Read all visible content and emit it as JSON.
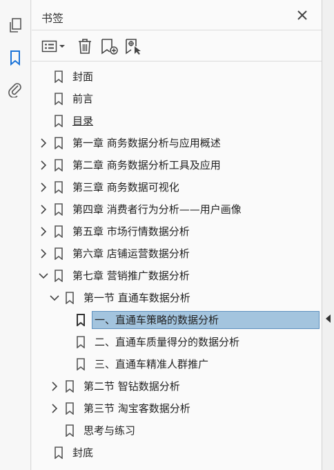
{
  "panel": {
    "title": "书签"
  },
  "rail": {
    "icons": [
      "pages-icon",
      "bookmark-icon",
      "attachment-icon"
    ]
  },
  "toolbar": {
    "icons": [
      "options-menu-icon",
      "delete-icon",
      "new-bookmark-icon",
      "bookmark-from-structure-icon"
    ]
  },
  "bookmarks": [
    {
      "label": "封面",
      "level": 0,
      "expander": "none"
    },
    {
      "label": "前言",
      "level": 0,
      "expander": "none"
    },
    {
      "label": "目录",
      "level": 0,
      "expander": "none",
      "underline": true
    },
    {
      "label": "第一章 商务数据分析与应用概述",
      "level": 0,
      "expander": "collapsed"
    },
    {
      "label": "第二章 商务数据分析工具及应用",
      "level": 0,
      "expander": "collapsed"
    },
    {
      "label": "第三章 商务数据可视化",
      "level": 0,
      "expander": "collapsed"
    },
    {
      "label": "第四章 消费者行为分析——用户画像",
      "level": 0,
      "expander": "collapsed"
    },
    {
      "label": "第五章 市场行情数据分析",
      "level": 0,
      "expander": "collapsed"
    },
    {
      "label": "第六章 店铺运营数据分析",
      "level": 0,
      "expander": "collapsed"
    },
    {
      "label": "第七章 营销推广数据分析",
      "level": 0,
      "expander": "expanded"
    },
    {
      "label": "第一节 直通车数据分析",
      "level": 1,
      "expander": "expanded"
    },
    {
      "label": "一、直通车策略的数据分析",
      "level": 2,
      "expander": "none",
      "selected": true
    },
    {
      "label": "二、直通车质量得分的数据分析",
      "level": 2,
      "expander": "none"
    },
    {
      "label": "三、直通车精准人群推广",
      "level": 2,
      "expander": "none"
    },
    {
      "label": "第二节 智钻数据分析",
      "level": 1,
      "expander": "collapsed"
    },
    {
      "label": "第三节 淘宝客数据分析",
      "level": 1,
      "expander": "collapsed"
    },
    {
      "label": "思考与练习",
      "level": 1,
      "expander": "none"
    },
    {
      "label": "封底",
      "level": 0,
      "expander": "none"
    }
  ],
  "colors": {
    "accent": "#1a73d8",
    "selection": "#a3c4de",
    "selection_border": "#5b8fbf"
  }
}
